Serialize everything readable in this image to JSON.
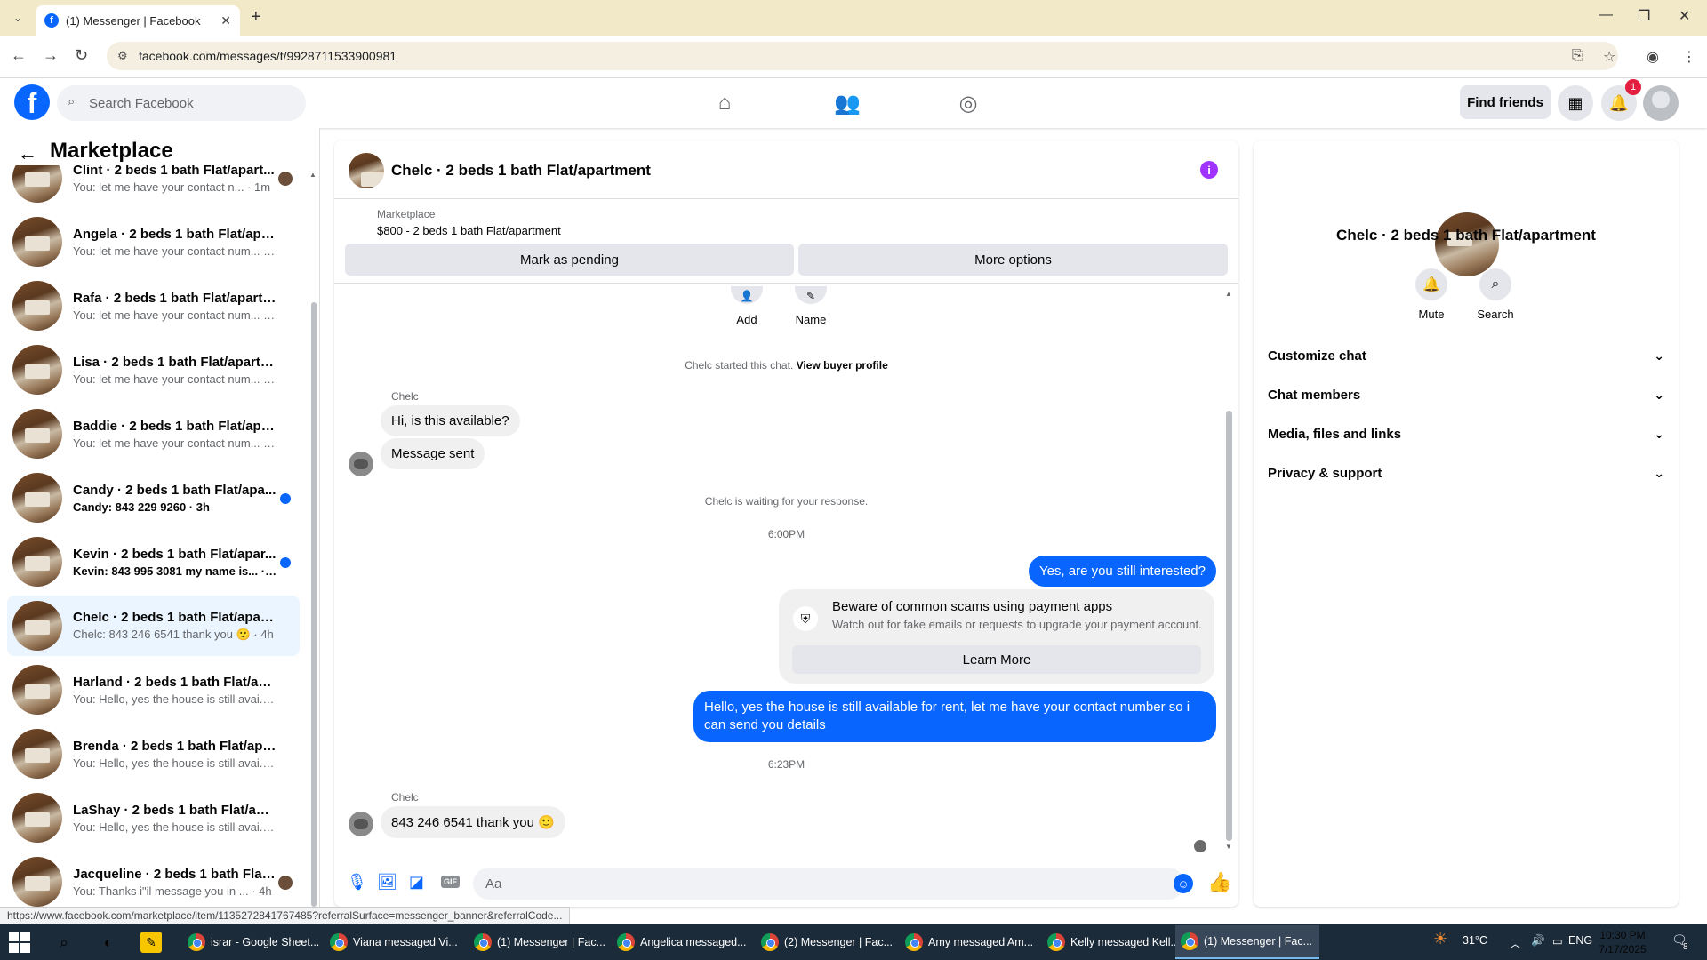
{
  "browser": {
    "tab_title": "(1) Messenger | Facebook",
    "url": "facebook.com/messages/t/9928711533900981",
    "status_url": "https://www.facebook.com/marketplace/item/1135272841767485?referralSurface=messenger_banner&referralCode..."
  },
  "fb": {
    "logo": "f",
    "search_placeholder": "Search Facebook",
    "find_friends": "Find friends",
    "notif_count": "1"
  },
  "sidebar": {
    "title": "Marketplace",
    "conversations": [
      {
        "name": "Clint · 2 beds 1 bath Flat/apart...",
        "preview": "You: let me have your contact n... · 1m",
        "status": "seen"
      },
      {
        "name": "Angela · 2 beds 1 bath Flat/apart...",
        "preview": "You: let me have your contact num... · 1m",
        "status": ""
      },
      {
        "name": "Rafa · 2 beds 1 bath Flat/apartm...",
        "preview": "You: let me have your contact num... · 1m",
        "status": ""
      },
      {
        "name": "Lisa · 2 beds 1 bath Flat/apartme...",
        "preview": "You: let me have your contact num... · 1m",
        "status": ""
      },
      {
        "name": "Baddie · 2 beds 1 bath Flat/apart...",
        "preview": "You: let me have your contact num... · 1m",
        "status": ""
      },
      {
        "name": "Candy · 2 beds 1 bath Flat/apa...",
        "preview": "Candy: 843 229 9260 · 3h",
        "status": "unread"
      },
      {
        "name": "Kevin · 2 beds 1 bath Flat/apar...",
        "preview": "Kevin: 843 995 3081 my name is... · 3h",
        "status": "unread"
      },
      {
        "name": "Chelc · 2 beds 1 bath Flat/apart...",
        "preview": "Chelc: 843 246 6541 thank you 🙂 · 4h",
        "status": "active"
      },
      {
        "name": "Harland · 2 beds 1 bath Flat/apa...",
        "preview": "You: Hello, yes the house is still avai... 4h",
        "status": ""
      },
      {
        "name": "Brenda · 2 beds 1 bath Flat/apar...",
        "preview": "You: Hello, yes the house is still avai... 4h",
        "status": ""
      },
      {
        "name": "LaShay · 2 beds 1 bath Flat/apart...",
        "preview": "You: Hello, yes the house is still avai... 4h",
        "status": ""
      },
      {
        "name": "Jacqueline · 2 beds 1 bath Flat...",
        "preview": "You: Thanks i\"il message you in ... · 4h",
        "status": "seen"
      }
    ]
  },
  "chat": {
    "title": "Chelc · 2 beds 1 bath Flat/apartment",
    "marketplace_label": "Marketplace",
    "listing": "$800 - 2 beds 1 bath Flat/apartment",
    "mark_pending": "Mark as pending",
    "more_options": "More options",
    "quick_actions": [
      "Add",
      "Name"
    ],
    "started_text": "Chelc started this chat.",
    "view_profile": "View buyer profile",
    "sender_name": "Chelc",
    "msg1": "Hi, is this available?",
    "msg2": "Message sent",
    "waiting": "Chelc is waiting for your response.",
    "time1": "6:00PM",
    "out1": "Yes, are you still interested?",
    "scam_title": "Beware of common scams using payment apps",
    "scam_desc": "Watch out for fake emails or requests to upgrade your payment account.",
    "learn_more": "Learn More",
    "out2": "Hello, yes the house is still available for rent, let me have your contact number so i can send you details",
    "time2": "6:23PM",
    "msg3": "843 246 6541 thank you 🙂",
    "input_placeholder": "Aa"
  },
  "panel": {
    "name": "Chelc · 2 beds 1 bath Flat/apartment",
    "mute": "Mute",
    "search": "Search",
    "sections": [
      "Customize chat",
      "Chat members",
      "Media, files and links",
      "Privacy & support"
    ]
  },
  "taskbar": {
    "apps": [
      "israr - Google Sheet...",
      "Viana messaged Vi...",
      "(1) Messenger | Fac...",
      "Angelica messaged...",
      "(2) Messenger | Fac...",
      "Amy messaged Am...",
      "Kelly messaged Kell...",
      "(1) Messenger | Fac..."
    ],
    "temp": "31°C",
    "lang": "ENG",
    "time": "10:30 PM",
    "date": "7/17/2025",
    "notif": "8"
  }
}
